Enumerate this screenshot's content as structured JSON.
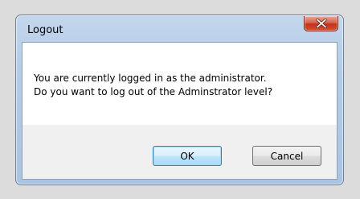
{
  "window": {
    "title": "Logout"
  },
  "message": {
    "line1": "You are currently logged in as the administrator.",
    "line2": "Do you want to log out of the Adminstrator level?"
  },
  "buttons": {
    "ok_label": "OK",
    "cancel_label": "Cancel"
  },
  "icons": {
    "close": "close-icon"
  },
  "colors": {
    "close_button": "#c7422a",
    "default_button_border": "#3c7fb1",
    "frame": "#b3cbe6"
  }
}
